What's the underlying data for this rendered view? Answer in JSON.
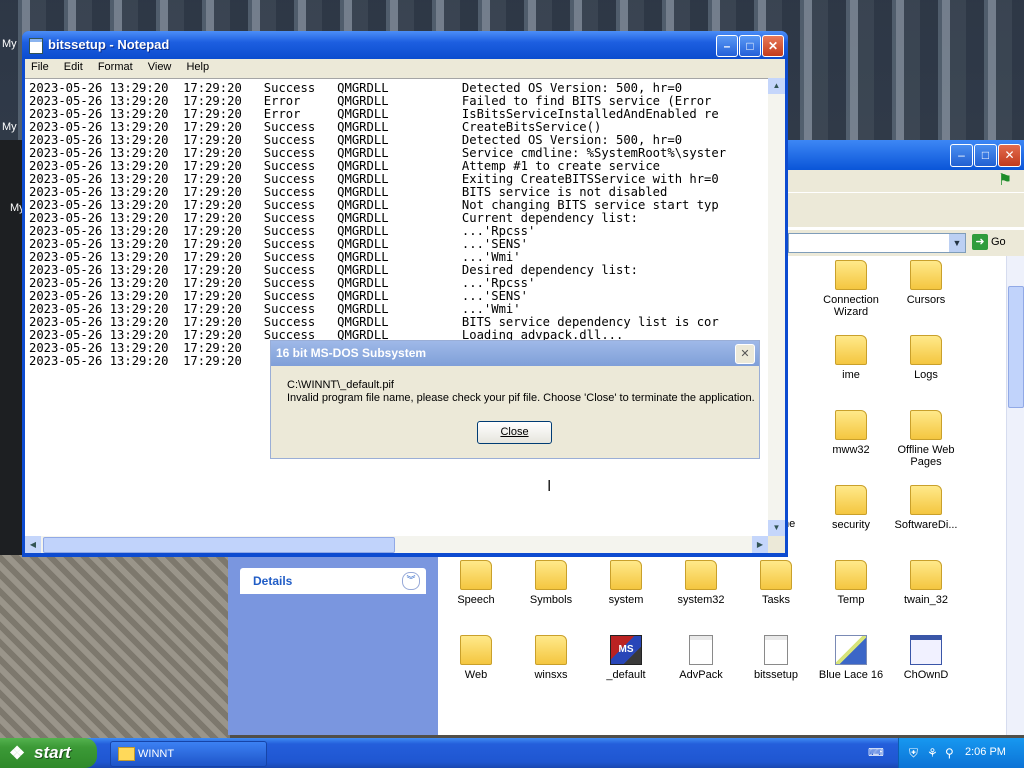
{
  "desktop": {
    "icons": [
      "My",
      "My",
      "My"
    ]
  },
  "explorer": {
    "go_label": "Go",
    "details_label": "Details",
    "partial_label": "ne",
    "files": [
      {
        "name": "Connection Wizard",
        "kind": "folder"
      },
      {
        "name": "Cursors",
        "kind": "folder"
      },
      {
        "name": "ime",
        "kind": "folder"
      },
      {
        "name": "Logs",
        "kind": "folder"
      },
      {
        "name": "mww32",
        "kind": "folder"
      },
      {
        "name": "Offline Web Pages",
        "kind": "folder"
      },
      {
        "name": "security",
        "kind": "folder"
      },
      {
        "name": "SoftwareDi...",
        "kind": "folder"
      },
      {
        "name": "Speech",
        "kind": "folder"
      },
      {
        "name": "Symbols",
        "kind": "folder"
      },
      {
        "name": "system",
        "kind": "folder"
      },
      {
        "name": "system32",
        "kind": "folder"
      },
      {
        "name": "Tasks",
        "kind": "folder"
      },
      {
        "name": "Temp",
        "kind": "folder"
      },
      {
        "name": "twain_32",
        "kind": "folder"
      },
      {
        "name": "Web",
        "kind": "folder"
      },
      {
        "name": "winsxs",
        "kind": "folder"
      },
      {
        "name": "_default",
        "kind": "msdos"
      },
      {
        "name": "AdvPack",
        "kind": "doc"
      },
      {
        "name": "bitssetup",
        "kind": "doc"
      },
      {
        "name": "Blue Lace 16",
        "kind": "pen"
      },
      {
        "name": "ChOwnD",
        "kind": "app"
      }
    ]
  },
  "notepad": {
    "title": "bitssetup - Notepad",
    "menu": [
      "File",
      "Edit",
      "Format",
      "View",
      "Help"
    ],
    "lines": [
      "2023-05-26 13:29:20  17:29:20   Success   QMGRDLL          Detected OS Version: 500, hr=0",
      "2023-05-26 13:29:20  17:29:20   Error     QMGRDLL          Failed to find BITS service (Error",
      "2023-05-26 13:29:20  17:29:20   Error     QMGRDLL          IsBitsServiceInstalledAndEnabled re",
      "2023-05-26 13:29:20  17:29:20   Success   QMGRDLL          CreateBitsService()",
      "2023-05-26 13:29:20  17:29:20   Success   QMGRDLL          Detected OS Version: 500, hr=0",
      "2023-05-26 13:29:20  17:29:20   Success   QMGRDLL          Service cmdline: %SystemRoot%\\syster",
      "2023-05-26 13:29:20  17:29:20   Success   QMGRDLL          Attemp #1 to create service",
      "2023-05-26 13:29:20  17:29:20   Success   QMGRDLL          Exiting CreateBITSService with hr=0",
      "2023-05-26 13:29:20  17:29:20   Success   QMGRDLL          BITS service is not disabled",
      "2023-05-26 13:29:20  17:29:20   Success   QMGRDLL          Not changing BITS service start typ",
      "2023-05-26 13:29:20  17:29:20   Success   QMGRDLL          Current dependency list:",
      "2023-05-26 13:29:20  17:29:20   Success   QMGRDLL          ...'Rpcss'",
      "2023-05-26 13:29:20  17:29:20   Success   QMGRDLL          ...'SENS'",
      "2023-05-26 13:29:20  17:29:20   Success   QMGRDLL          ...'Wmi'",
      "2023-05-26 13:29:20  17:29:20   Success   QMGRDLL          Desired dependency list:",
      "2023-05-26 13:29:20  17:29:20   Success   QMGRDLL          ...'Rpcss'",
      "2023-05-26 13:29:20  17:29:20   Success   QMGRDLL          ...'SENS'",
      "2023-05-26 13:29:20  17:29:20   Success   QMGRDLL          ...'Wmi'",
      "2023-05-26 13:29:20  17:29:20   Success   QMGRDLL          BITS service dependency list is cor",
      "2023-05-26 13:29:20  17:29:20   Success   QMGRDLL          Loading advpack.dll...",
      "2023-05-26 13:29:20  17:29:20",
      "2023-05-26 13:29:20  17:29:20                                                                    y"
    ]
  },
  "dialog": {
    "title": "16 bit MS-DOS Subsystem",
    "path": "C:\\WINNT\\_default.pif",
    "message": "Invalid program file name, please check your pif file. Choose 'Close' to terminate the application.",
    "close_label": "Close"
  },
  "taskbar": {
    "start_label": "start",
    "task_label": "WINNT",
    "clock": "2:06 PM"
  }
}
